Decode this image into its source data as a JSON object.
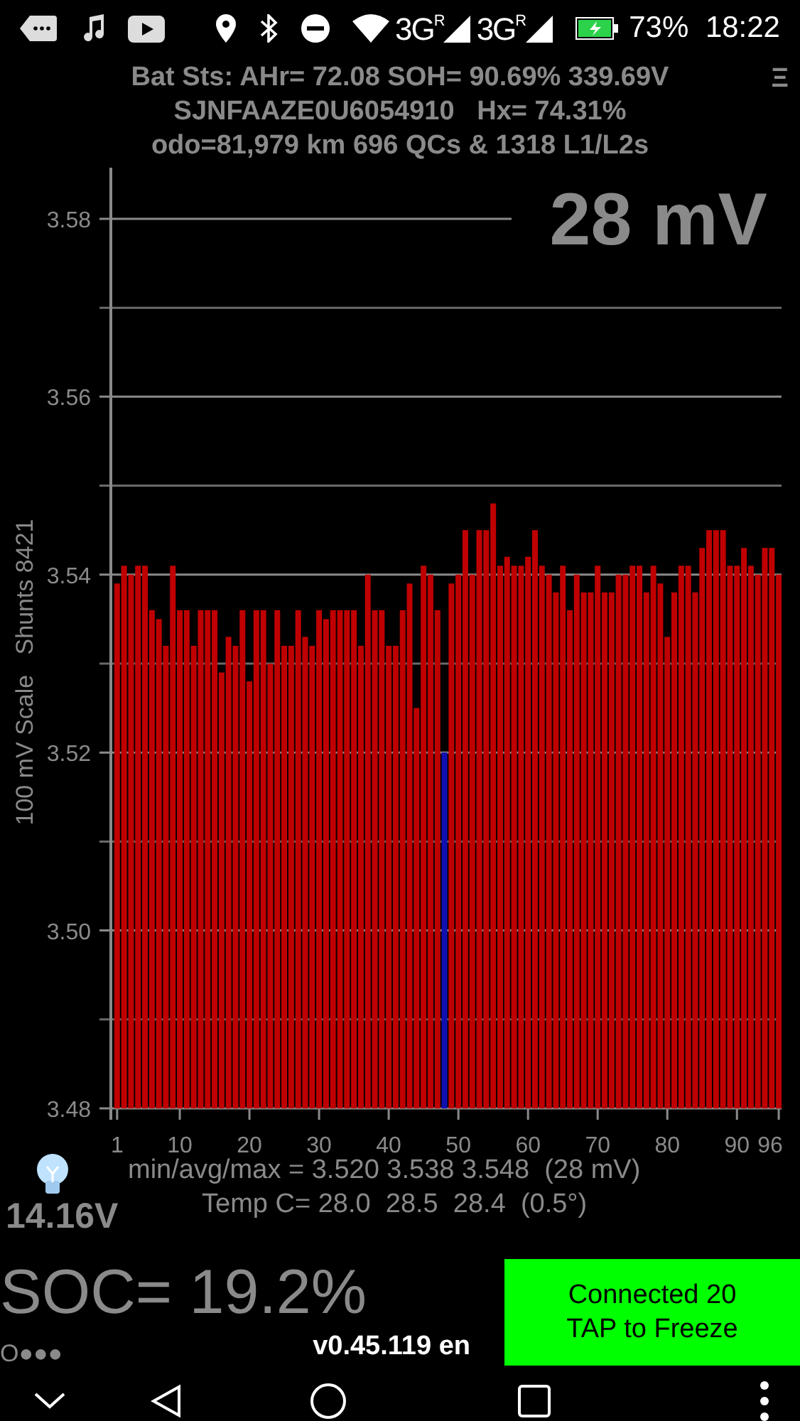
{
  "status_bar": {
    "networks": [
      {
        "label": "3G",
        "roaming": "R"
      },
      {
        "label": "3G",
        "roaming": "R"
      }
    ],
    "battery": "73%",
    "time": "18:22"
  },
  "header": {
    "lines": [
      "Bat Sts: AHr= 72.08 SOH= 90.69% 339.69V",
      "SJNFAAZE0U6054910   Hx= 74.31%",
      "odo=81,979 km 696 QCs & 1318 L1/L2s"
    ],
    "menu": "Ξ"
  },
  "chart_data": {
    "type": "bar",
    "title": "28 mV",
    "ylabel": "100 mV Scale   Shunts 8421",
    "grid": true,
    "x": [
      1,
      2,
      3,
      4,
      5,
      6,
      7,
      8,
      9,
      10,
      11,
      12,
      13,
      14,
      15,
      16,
      17,
      18,
      19,
      20,
      21,
      22,
      23,
      24,
      25,
      26,
      27,
      28,
      29,
      30,
      31,
      32,
      33,
      34,
      35,
      36,
      37,
      38,
      39,
      40,
      41,
      42,
      43,
      44,
      45,
      46,
      47,
      48,
      49,
      50,
      51,
      52,
      53,
      54,
      55,
      56,
      57,
      58,
      59,
      60,
      61,
      62,
      63,
      64,
      65,
      66,
      67,
      68,
      69,
      70,
      71,
      72,
      73,
      74,
      75,
      76,
      77,
      78,
      79,
      80,
      81,
      82,
      83,
      84,
      85,
      86,
      87,
      88,
      89,
      90,
      91,
      92,
      93,
      94,
      95,
      96
    ],
    "series": [
      {
        "color": "#c00000",
        "values": [
          3.539,
          3.541,
          3.54,
          3.541,
          3.541,
          3.536,
          3.535,
          3.532,
          3.541,
          3.536,
          3.536,
          3.532,
          3.536,
          3.536,
          3.536,
          3.529,
          3.533,
          3.532,
          3.536,
          3.528,
          3.536,
          3.536,
          3.53,
          3.536,
          3.532,
          3.532,
          3.536,
          3.533,
          3.532,
          3.536,
          3.535,
          3.536,
          3.536,
          3.536,
          3.536,
          3.532,
          3.54,
          3.536,
          3.536,
          3.532,
          3.532,
          3.536,
          3.539,
          3.525,
          3.541,
          3.54,
          3.536,
          null,
          3.539,
          3.54,
          3.545,
          3.54,
          3.545,
          3.545,
          3.548,
          3.541,
          3.542,
          3.541,
          3.541,
          3.542,
          3.545,
          3.541,
          3.54,
          3.538,
          3.541,
          3.536,
          3.54,
          3.538,
          3.538,
          3.541,
          3.538,
          3.538,
          3.54,
          3.54,
          3.541,
          3.541,
          3.538,
          3.541,
          3.539,
          3.533,
          3.538,
          3.541,
          3.541,
          3.538,
          3.543,
          3.545,
          3.545,
          3.545,
          3.541,
          3.541,
          3.543,
          3.541,
          3.54,
          3.543,
          3.543,
          3.54
        ]
      },
      {
        "color": "#1010b0",
        "values": [
          null,
          null,
          null,
          null,
          null,
          null,
          null,
          null,
          null,
          null,
          null,
          null,
          null,
          null,
          null,
          null,
          null,
          null,
          null,
          null,
          null,
          null,
          null,
          null,
          null,
          null,
          null,
          null,
          null,
          null,
          null,
          null,
          null,
          null,
          null,
          null,
          null,
          null,
          null,
          null,
          null,
          null,
          null,
          null,
          null,
          null,
          null,
          3.52,
          null,
          null,
          null,
          null,
          null,
          null,
          null,
          null,
          null,
          null,
          null,
          null,
          null,
          null,
          null,
          null,
          null,
          null,
          null,
          null,
          null,
          null,
          null,
          null,
          null,
          null,
          null,
          null,
          null,
          null,
          null,
          null,
          null,
          null,
          null,
          null,
          null,
          null,
          null,
          null,
          null,
          null,
          null,
          null,
          null,
          null,
          null,
          null
        ]
      }
    ],
    "xlim": [
      0.1,
      96.4
    ],
    "ylim": [
      3.48,
      3.586
    ],
    "yticks": [
      3.48,
      {
        "value": 3.5,
        "label": "3.50"
      },
      3.52,
      3.54,
      3.56,
      3.58
    ],
    "xticks": [
      1,
      10,
      20,
      30,
      40,
      50,
      60,
      70,
      80,
      90,
      96
    ]
  },
  "footer": {
    "min_avg_max": "min/avg/max = 3.520 3.538 3.548  (28 mV)",
    "temp": "Temp C= 28.0  28.5  28.4  (0.5°)",
    "voltage": "14.16V",
    "soc": "SOC= 19.2%",
    "progress": "O●●●",
    "version": "v0.45.119 en",
    "button_lines": [
      "Connected 20",
      "TAP to Freeze"
    ]
  }
}
